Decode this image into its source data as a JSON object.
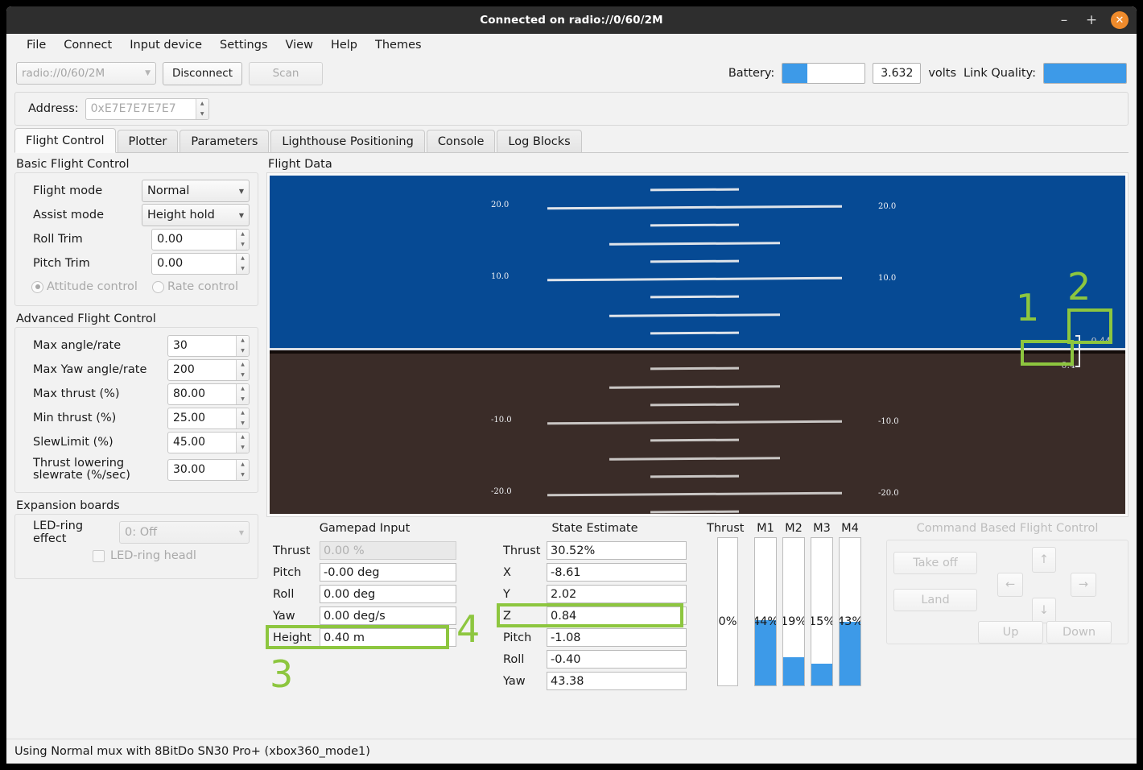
{
  "window": {
    "title": "Connected on radio://0/60/2M",
    "minimize_label": "–",
    "maximize_label": "+",
    "close_label": "✕"
  },
  "menubar": {
    "items": [
      {
        "label": "File"
      },
      {
        "label": "Connect"
      },
      {
        "label": "Input device"
      },
      {
        "label": "Settings"
      },
      {
        "label": "View"
      },
      {
        "label": "Help"
      },
      {
        "label": "Themes"
      }
    ]
  },
  "toolbar": {
    "uri_value": "radio://0/60/2M",
    "disconnect_label": "Disconnect",
    "scan_label": "Scan",
    "battery_label": "Battery:",
    "battery_percent": 30,
    "battery_volts": "3.632",
    "volts_label": "volts",
    "link_quality_label": "Link Quality:",
    "link_quality_percent": 100,
    "accent_blue": "#3d9ae8"
  },
  "address": {
    "label": "Address:",
    "value": "0xE7E7E7E7E7"
  },
  "tabs": [
    {
      "label": "Flight Control",
      "active": true
    },
    {
      "label": "Plotter",
      "active": false
    },
    {
      "label": "Parameters",
      "active": false
    },
    {
      "label": "Lighthouse Positioning",
      "active": false
    },
    {
      "label": "Console",
      "active": false
    },
    {
      "label": "Log Blocks",
      "active": false
    }
  ],
  "basic_flight_control": {
    "title": "Basic Flight Control",
    "flight_mode_label": "Flight mode",
    "flight_mode_value": "Normal",
    "assist_mode_label": "Assist mode",
    "assist_mode_value": "Height hold",
    "roll_trim_label": "Roll Trim",
    "roll_trim_value": "0.00",
    "pitch_trim_label": "Pitch Trim",
    "pitch_trim_value": "0.00",
    "attitude_control_label": "Attitude control",
    "rate_control_label": "Rate control"
  },
  "advanced_flight_control": {
    "title": "Advanced Flight Control",
    "rows": [
      {
        "label": "Max angle/rate",
        "value": "30"
      },
      {
        "label": "Max Yaw angle/rate",
        "value": "200"
      },
      {
        "label": "Max thrust (%)",
        "value": "80.00"
      },
      {
        "label": "Min thrust (%)",
        "value": "25.00"
      },
      {
        "label": "SlewLimit (%)",
        "value": "45.00"
      },
      {
        "label": "Thrust lowering slewrate (%/sec)",
        "value": "30.00"
      }
    ]
  },
  "expansion_boards": {
    "title": "Expansion boards",
    "led_ring_effect_label": "LED-ring effect",
    "led_ring_effect_value": "0: Off",
    "led_ring_headlight_label": "LED-ring headl"
  },
  "flight_data": {
    "title": "Flight Data",
    "sky_color": "#064a94",
    "ground_color": "#3a2c28",
    "pitch_labels": [
      "20.0",
      "10.0",
      "-10.0",
      "-20.0"
    ],
    "altitude_target": "0.44",
    "altitude_current": "0.4"
  },
  "gamepad_input": {
    "title": "Gamepad Input",
    "rows": [
      {
        "label": "Thrust",
        "value": "0.00 %",
        "dim": true
      },
      {
        "label": "Pitch",
        "value": "-0.00 deg",
        "dim": false
      },
      {
        "label": "Roll",
        "value": "0.00 deg",
        "dim": false
      },
      {
        "label": "Yaw",
        "value": "0.00 deg/s",
        "dim": false
      },
      {
        "label": "Height",
        "value": "0.40 m",
        "dim": false
      }
    ]
  },
  "state_estimate": {
    "title": "State Estimate",
    "rows": [
      {
        "label": "Thrust",
        "value": "30.52%"
      },
      {
        "label": "X",
        "value": "-8.61"
      },
      {
        "label": "Y",
        "value": "2.02"
      },
      {
        "label": "Z",
        "value": "0.84"
      },
      {
        "label": "Pitch",
        "value": "-1.08"
      },
      {
        "label": "Roll",
        "value": "-0.40"
      },
      {
        "label": "Yaw",
        "value": "43.38"
      }
    ]
  },
  "motors": {
    "thrust_label": "Thrust",
    "thrust_text": "0%",
    "thrust_percent": 0,
    "bars": [
      {
        "label": "M1",
        "text": "44%",
        "percent": 44
      },
      {
        "label": "M2",
        "text": "19%",
        "percent": 19
      },
      {
        "label": "M3",
        "text": "15%",
        "percent": 15
      },
      {
        "label": "M4",
        "text": "43%",
        "percent": 43
      }
    ]
  },
  "command_flight_control": {
    "title": "Command Based Flight Control",
    "take_off_label": "Take off",
    "land_label": "Land",
    "up_label": "Up",
    "down_label": "Down",
    "arrow_up": "↑",
    "arrow_down": "↓",
    "arrow_left": "←",
    "arrow_right": "→"
  },
  "annotations": {
    "color": "#8dc63f",
    "markers": [
      {
        "num": "1",
        "target": "altitude-current-readout"
      },
      {
        "num": "2",
        "target": "altitude-target-readout"
      },
      {
        "num": "3",
        "target": "gamepad-height-row"
      },
      {
        "num": "4",
        "target": "state-estimate-z-row"
      }
    ]
  },
  "statusbar": {
    "text": "Using Normal mux with 8BitDo SN30 Pro+ (xbox360_mode1)"
  }
}
